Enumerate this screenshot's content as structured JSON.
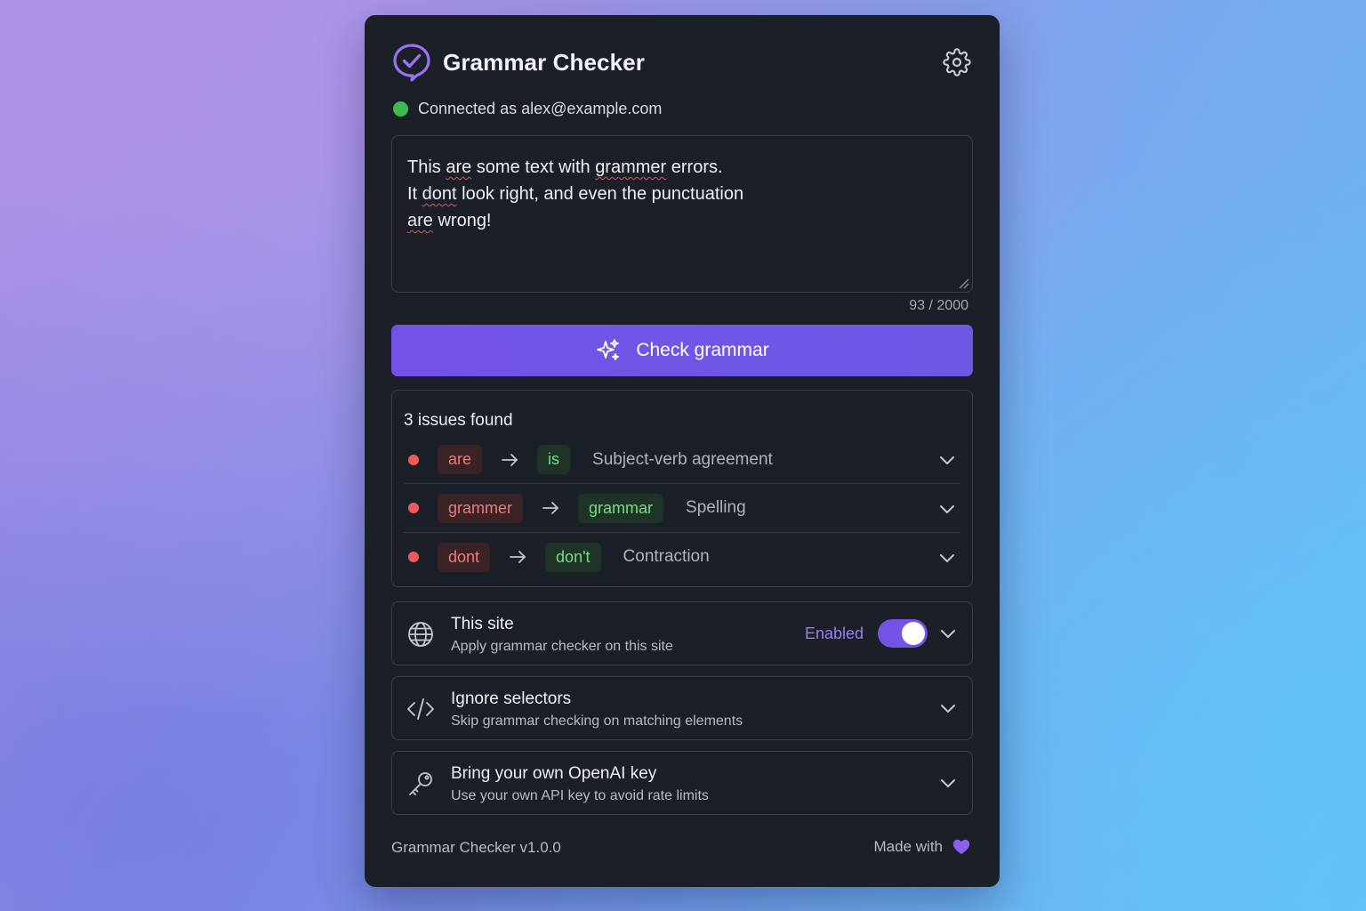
{
  "app": {
    "title": "Grammar Checker",
    "accent": "#7452e8"
  },
  "status": {
    "text": "Connected as alex@example.com",
    "color": "#3fb950"
  },
  "editor": {
    "line1": {
      "a": "This ",
      "e1": "are",
      "b": " some text with ",
      "e2": "grammer",
      "c": " errors."
    },
    "line2": {
      "a": "It ",
      "e1": "dont",
      "b": " look right, and even the punctuation"
    },
    "line3": {
      "e1": "are",
      "b": " wrong!"
    },
    "counter": "93 / 2000"
  },
  "check_button": {
    "label": "Check grammar",
    "icon": "sparkles-icon"
  },
  "issues": {
    "title": "3 issues found",
    "items": [
      {
        "original": "are",
        "suggestion": "is",
        "type": "Subject-verb agreement"
      },
      {
        "original": "grammer",
        "suggestion": "grammar",
        "type": "Spelling"
      },
      {
        "original": "dont",
        "suggestion": "don't",
        "type": "Contraction"
      }
    ]
  },
  "settings": {
    "this_site": {
      "title": "This site",
      "subtitle": "Apply grammar checker on this site",
      "state_label": "Enabled",
      "enabled": true,
      "icon": "globe-icon"
    },
    "ignore_selectors": {
      "title": "Ignore selectors",
      "subtitle": "Skip grammar checking on matching elements",
      "icon": "code-icon"
    },
    "openai_key": {
      "title": "Bring your own OpenAI key",
      "subtitle": "Use your own API key to avoid rate limits",
      "icon": "key-icon"
    }
  },
  "footer": {
    "version": "Grammar Checker v1.0.0",
    "made_with": "Made with",
    "heart_icon": "heart-icon"
  }
}
